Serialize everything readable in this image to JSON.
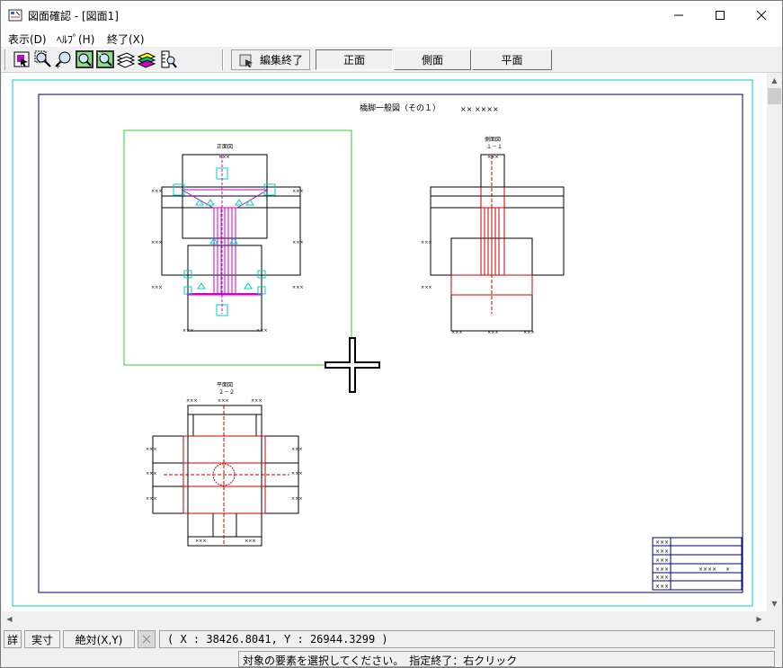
{
  "window": {
    "title": "図面確認 - [図面1]",
    "app_icon": "drawing-app-icon"
  },
  "menu": {
    "items": [
      {
        "label": "表示(D)"
      },
      {
        "label": "ﾍﾙﾌﾟ(H)"
      },
      {
        "label": "終了(X)"
      }
    ]
  },
  "toolbar": {
    "edit_end_label": "編集終了",
    "views": [
      {
        "label": "正面",
        "active": true
      },
      {
        "label": "側面",
        "active": false
      },
      {
        "label": "平面",
        "active": false
      }
    ]
  },
  "drawing": {
    "title": "橋脚一般図（その１）",
    "title_suffix": "×× ××××",
    "front_label": "正面図",
    "side_label_1": "側面図",
    "side_label_2": "１－１",
    "plan_label_1": "平面図",
    "plan_label_2": "２－２",
    "dim_text": "×××",
    "table_cell": "×××",
    "table_mid_a": "××××",
    "table_mid_b": "×"
  },
  "coordbar": {
    "detail_label": "詳",
    "actual_label": "実寸",
    "absolute_label": "絶対(X,Y)",
    "coords": "( X : 38426.8041, Y : 26944.3299 )"
  },
  "status": {
    "message": "対象の要素を選択してください。　指定終了：右クリック"
  },
  "colors": {
    "selection_green": "#33cc33",
    "cyan": "#00cccc",
    "magenta": "#cc00cc",
    "red": "#cc0000",
    "frame_navy": "#000080"
  }
}
